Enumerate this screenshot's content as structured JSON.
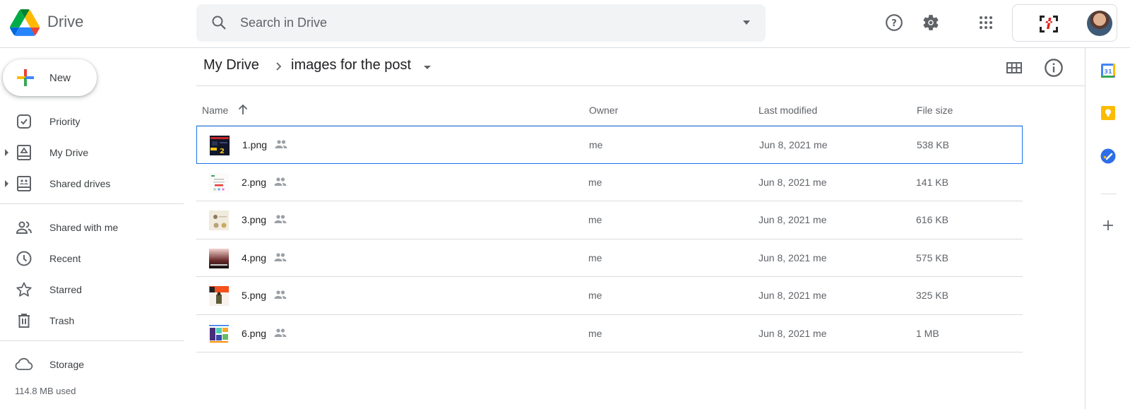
{
  "app": {
    "name": "Drive",
    "colors": {
      "accent": "#1a73e8",
      "green": "#34a853",
      "yellow": "#fbbc04",
      "red": "#ea4335",
      "blue": "#4285f4"
    }
  },
  "search": {
    "placeholder": "Search in Drive",
    "value": ""
  },
  "header_icons": [
    "help-icon",
    "settings-icon",
    "apps-icon",
    "account-brand-logo",
    "avatar"
  ],
  "sidebar": {
    "new_label": "New",
    "items": [
      {
        "label": "Priority",
        "icon": "priority-icon",
        "expandable": false
      },
      {
        "label": "My Drive",
        "icon": "my-drive-icon",
        "expandable": true
      },
      {
        "label": "Shared drives",
        "icon": "shared-drives-icon",
        "expandable": true
      },
      {
        "label": "Shared with me",
        "icon": "shared-with-me-icon",
        "expandable": false
      },
      {
        "label": "Recent",
        "icon": "clock-icon",
        "expandable": false
      },
      {
        "label": "Starred",
        "icon": "star-icon",
        "expandable": false
      },
      {
        "label": "Trash",
        "icon": "trash-icon",
        "expandable": false
      },
      {
        "label": "Storage",
        "icon": "cloud-icon",
        "expandable": false
      }
    ],
    "storage_used": "114.8 MB used"
  },
  "breadcrumb": {
    "root": "My Drive",
    "current": "images for the post"
  },
  "table": {
    "columns": {
      "name": "Name",
      "owner": "Owner",
      "modified": "Last modified",
      "size": "File size"
    },
    "sort": {
      "column": "Name",
      "direction": "ascending"
    },
    "rows": [
      {
        "name": "1.png",
        "owner": "me",
        "modified": "Jun 8, 2021  me",
        "size": "538 KB",
        "selected": true,
        "shared": true
      },
      {
        "name": "2.png",
        "owner": "me",
        "modified": "Jun 8, 2021  me",
        "size": "141 KB",
        "selected": false,
        "shared": true
      },
      {
        "name": "3.png",
        "owner": "me",
        "modified": "Jun 8, 2021  me",
        "size": "616 KB",
        "selected": false,
        "shared": true
      },
      {
        "name": "4.png",
        "owner": "me",
        "modified": "Jun 8, 2021  me",
        "size": "575 KB",
        "selected": false,
        "shared": true
      },
      {
        "name": "5.png",
        "owner": "me",
        "modified": "Jun 8, 2021  me",
        "size": "325 KB",
        "selected": false,
        "shared": true
      },
      {
        "name": "6.png",
        "owner": "me",
        "modified": "Jun 8, 2021  me",
        "size": "1 MB",
        "selected": false,
        "shared": true
      }
    ]
  },
  "side_panel": {
    "apps": [
      "Calendar",
      "Keep",
      "Tasks"
    ],
    "calendar_day": "31",
    "add_label": "Get add-ons"
  }
}
